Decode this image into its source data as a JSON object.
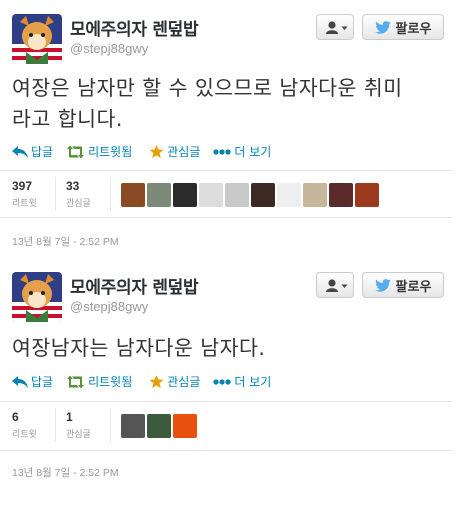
{
  "colors": {
    "link_blue": "#0084b4",
    "retweet_green": "#5c913b",
    "favorite_gold": "#e5a100",
    "muted_gray": "#999999",
    "twitter_bird": "#55acee"
  },
  "tweets": [
    {
      "name": "모에주의자 렌덮밥",
      "handle": "@stepj88gwy",
      "follow_label": "팔로우",
      "text_lines": [
        "여장은 남자만 할 수 있으므로 남자다운 취미",
        "라고 합니다."
      ],
      "actions": {
        "reply": "답글",
        "retweet": "리트윗됨",
        "favorite": "관심글",
        "more": "더 보기"
      },
      "retweets": {
        "count": "397",
        "label": "리트윗"
      },
      "favorites": {
        "count": "33",
        "label": "관심글"
      },
      "faver_avatar_colors": [
        "#8a4a24",
        "#7d8a78",
        "#2b2b2b",
        "#dcdcdc",
        "#c9c9c9",
        "#3a2a22",
        "#eeeeee",
        "#c7b79a",
        "#5b2a2a",
        "#9b3a1e"
      ],
      "timestamp": "13년 8월 7일 - 2:52 PM"
    },
    {
      "name": "모에주의자 렌덮밥",
      "handle": "@stepj88gwy",
      "follow_label": "팔로우",
      "text_lines": [
        "여장남자는 남자다운 남자다."
      ],
      "actions": {
        "reply": "답글",
        "retweet": "리트윗됨",
        "favorite": "관심글",
        "more": "더 보기"
      },
      "retweets": {
        "count": "6",
        "label": "리트윗"
      },
      "favorites": {
        "count": "1",
        "label": "관심글"
      },
      "faver_avatar_colors": [
        "#555555",
        "#3b5a3b",
        "#e8500e"
      ],
      "timestamp": "13년 8월 7일 - 2:52 PM"
    }
  ]
}
